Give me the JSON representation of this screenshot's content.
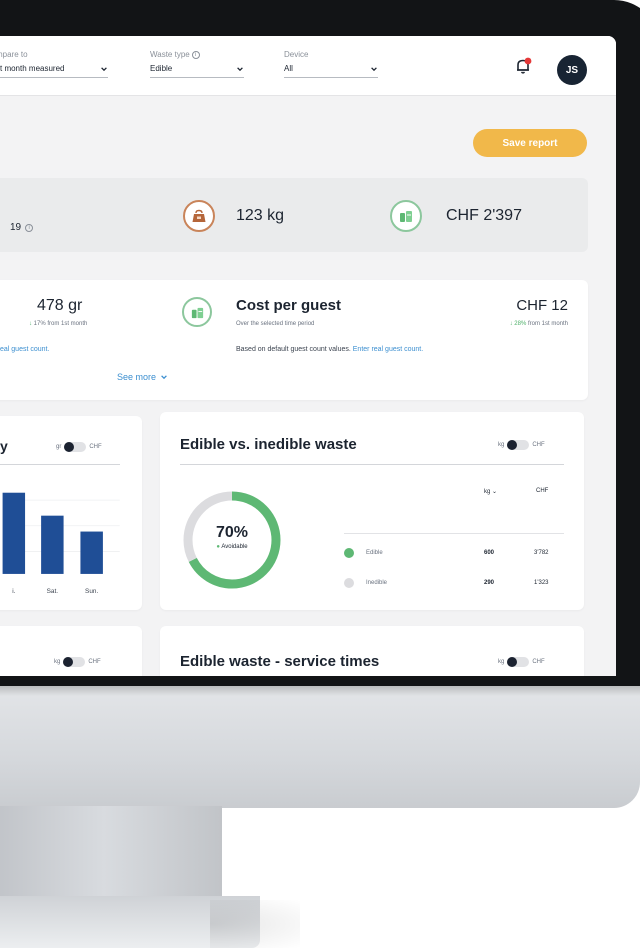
{
  "topbar": {
    "compare": {
      "label": "mpare to",
      "value": "st month measured"
    },
    "waste_type": {
      "label": "Waste type",
      "value": "Edible"
    },
    "device": {
      "label": "Device",
      "value": "All"
    },
    "avatar_initials": "JS",
    "icons": [
      "info-icon",
      "chevron-down-icon",
      "bell-icon",
      "notification-dot"
    ]
  },
  "actions": {
    "save_label": "Save report"
  },
  "summary": {
    "date_fragment": "19",
    "weight": "123 kg",
    "cost": "CHF 2'397"
  },
  "per_guest": {
    "value": "478 gr",
    "delta_arrow": "↓",
    "delta_text": "17% from 1st month",
    "note": "eal guest count."
  },
  "cost_per_guest": {
    "title": "Cost per guest",
    "subtitle": "Over the selected time period",
    "value": "CHF 12",
    "delta_arrow": "↓",
    "delta_pct": "28%",
    "delta_text": "from 1st month",
    "note_prefix": "Based on default guest count values.",
    "note_link": "Enter real guest count."
  },
  "see_more": "See more",
  "weekly_card": {
    "title_fragment": "y",
    "toggle_left": "gr",
    "toggle_right": "CHF",
    "chart_data": {
      "type": "bar",
      "categories": [
        "i.",
        "Sat.",
        "Sun."
      ],
      "values": [
        0.92,
        0.66,
        0.48
      ],
      "color": "#1f4e96"
    }
  },
  "edible_card": {
    "title": "Edible vs. inedible waste",
    "toggle_left": "kg",
    "toggle_right": "CHF",
    "donut_pct": "70%",
    "donut_label": "Avoidable",
    "col_kg": "kg",
    "col_chf": "CHF",
    "chart_data": {
      "type": "pie",
      "categories": [
        "Edible",
        "Inedible"
      ],
      "values_kg": [
        600,
        290
      ],
      "values_chf": [
        "3'782",
        "1'323"
      ],
      "colors": [
        "#5eb874",
        "#dcdcdf"
      ]
    },
    "rows": [
      {
        "name": "Edible",
        "kg": "600",
        "chf": "3'782",
        "color": "#5eb874"
      },
      {
        "name": "Inedible",
        "kg": "290",
        "chf": "1'323",
        "color": "#dcdcdf"
      }
    ]
  },
  "lower_left": {
    "toggle_left": "kg",
    "toggle_right": "CHF"
  },
  "lower_right": {
    "title": "Edible waste - service times",
    "toggle_left": "kg",
    "toggle_right": "CHF"
  },
  "colors": {
    "accent": "#f1b84a",
    "navy": "#182433",
    "green": "#5eb874",
    "link": "#3c8fd0",
    "bar": "#1f4e96"
  }
}
